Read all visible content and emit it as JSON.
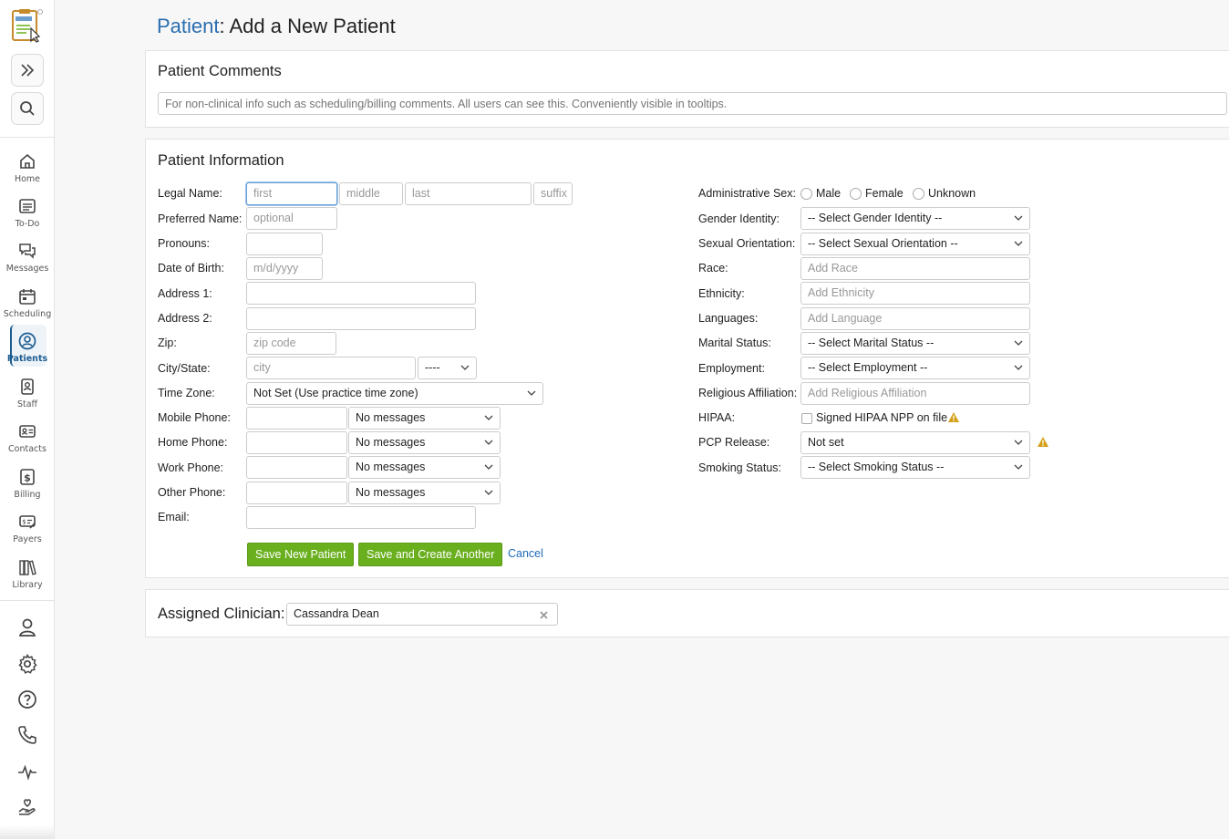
{
  "app": {
    "logo_text": "Therapy Notes"
  },
  "nav": [
    {
      "key": "home",
      "label": "Home",
      "icon": "home-icon"
    },
    {
      "key": "todo",
      "label": "To-Do",
      "icon": "list-icon"
    },
    {
      "key": "messages",
      "label": "Messages",
      "icon": "messages-icon"
    },
    {
      "key": "scheduling",
      "label": "Scheduling",
      "icon": "calendar-icon"
    },
    {
      "key": "patients",
      "label": "Patients",
      "icon": "patient-icon",
      "active": true
    },
    {
      "key": "staff",
      "label": "Staff",
      "icon": "badge-icon"
    },
    {
      "key": "contacts",
      "label": "Contacts",
      "icon": "contact-card-icon"
    },
    {
      "key": "billing",
      "label": "Billing",
      "icon": "dollar-icon"
    },
    {
      "key": "payers",
      "label": "Payers",
      "icon": "payer-icon"
    },
    {
      "key": "library",
      "label": "Library",
      "icon": "books-icon"
    }
  ],
  "page": {
    "title_prefix": "Patient",
    "title_rest": ": Add a New Patient"
  },
  "comments": {
    "title": "Patient Comments",
    "placeholder": "For non-clinical info such as scheduling/billing comments. All users can see this. Conveniently visible in tooltips."
  },
  "info": {
    "title": "Patient Information",
    "left": {
      "legal_name": "Legal Name:",
      "first_ph": "first",
      "middle_ph": "middle",
      "last_ph": "last",
      "suffix_ph": "suffix",
      "preferred_name": "Preferred Name:",
      "preferred_ph": "optional",
      "pronouns": "Pronouns:",
      "dob": "Date of Birth:",
      "dob_ph": "m/d/yyyy",
      "address1": "Address 1:",
      "address2": "Address 2:",
      "zip": "Zip:",
      "zip_ph": "zip code",
      "city_state": "City/State:",
      "city_ph": "city",
      "state_value": "----",
      "time_zone": "Time Zone:",
      "time_zone_value": "Not Set (Use practice time zone)",
      "mobile_phone": "Mobile Phone:",
      "home_phone": "Home Phone:",
      "work_phone": "Work Phone:",
      "other_phone": "Other Phone:",
      "messages_value": "No messages",
      "email": "Email:"
    },
    "right": {
      "admin_sex": "Administrative Sex:",
      "sex_options": [
        "Male",
        "Female",
        "Unknown"
      ],
      "gender_identity": "Gender Identity:",
      "gender_identity_value": "-- Select Gender Identity --",
      "sexual_orientation": "Sexual Orientation:",
      "sexual_orientation_value": "-- Select Sexual Orientation --",
      "race": "Race:",
      "race_ph": "Add Race",
      "ethnicity": "Ethnicity:",
      "ethnicity_ph": "Add Ethnicity",
      "languages": "Languages:",
      "languages_ph": "Add Language",
      "marital_status": "Marital Status:",
      "marital_status_value": "-- Select Marital Status --",
      "employment": "Employment:",
      "employment_value": "-- Select Employment --",
      "religious_affiliation": "Religious Affiliation:",
      "religious_ph": "Add Religious Affiliation",
      "hipaa": "HIPAA:",
      "hipaa_check": "Signed HIPAA NPP on file",
      "pcp_release": "PCP Release:",
      "pcp_release_value": "Not set",
      "smoking_status": "Smoking Status:",
      "smoking_status_value": "-- Select Smoking Status --"
    },
    "actions": {
      "save": "Save New Patient",
      "save_another": "Save and Create Another",
      "cancel": "Cancel"
    }
  },
  "clinician": {
    "label": "Assigned Clinician:",
    "value": "Cassandra Dean"
  },
  "colors": {
    "accent": "#2a6db0",
    "green": "#6aaf1e",
    "warning": "#d4a017"
  }
}
